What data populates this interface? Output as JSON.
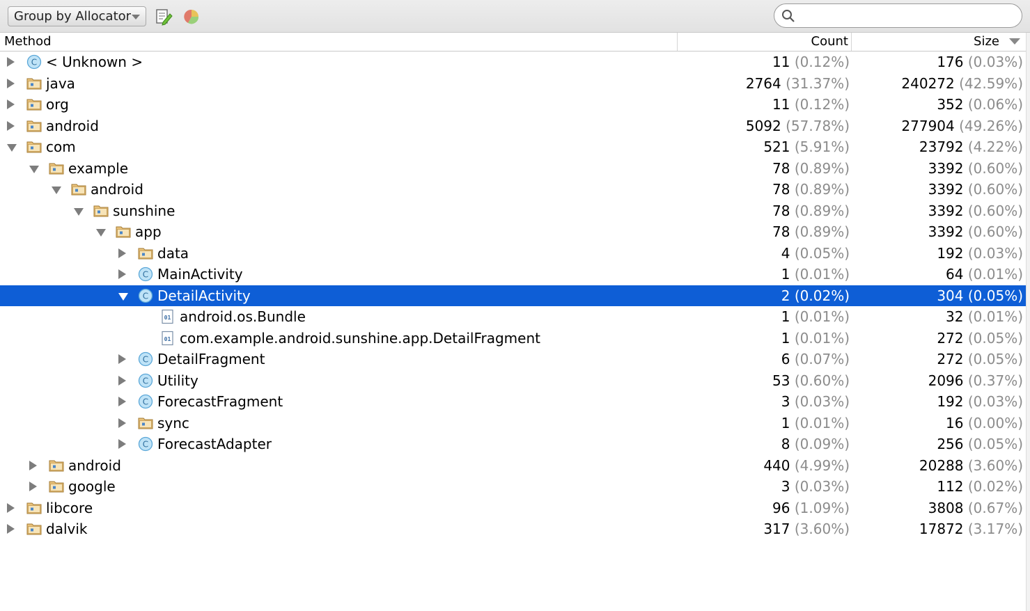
{
  "toolbar": {
    "group_by_label": "Group by Allocator",
    "icons": [
      "edit-export-icon",
      "pie-chart-icon",
      "search-icon"
    ],
    "search": {
      "value": "",
      "placeholder": ""
    }
  },
  "columns": {
    "method": "Method",
    "count": "Count",
    "size": "Size"
  },
  "colors": {
    "selection": "#0e5ed6",
    "percent": "#8c8c8c",
    "folder": "#c9a25a",
    "class_icon": "#7ec2e8"
  },
  "rows": [
    {
      "depth": 0,
      "state": "collapsed",
      "icon": "class",
      "name": "< Unknown >",
      "count": "11",
      "count_pct": "(0.12%)",
      "size": "176",
      "size_pct": "(0.03%)"
    },
    {
      "depth": 0,
      "state": "collapsed",
      "icon": "package",
      "name": "java",
      "count": "2764",
      "count_pct": "(31.37%)",
      "size": "240272",
      "size_pct": "(42.59%)"
    },
    {
      "depth": 0,
      "state": "collapsed",
      "icon": "package",
      "name": "org",
      "count": "11",
      "count_pct": "(0.12%)",
      "size": "352",
      "size_pct": "(0.06%)"
    },
    {
      "depth": 0,
      "state": "collapsed",
      "icon": "package",
      "name": "android",
      "count": "5092",
      "count_pct": "(57.78%)",
      "size": "277904",
      "size_pct": "(49.26%)"
    },
    {
      "depth": 0,
      "state": "expanded",
      "icon": "package",
      "name": "com",
      "count": "521",
      "count_pct": "(5.91%)",
      "size": "23792",
      "size_pct": "(4.22%)"
    },
    {
      "depth": 1,
      "state": "expanded",
      "icon": "package",
      "name": "example",
      "count": "78",
      "count_pct": "(0.89%)",
      "size": "3392",
      "size_pct": "(0.60%)"
    },
    {
      "depth": 2,
      "state": "expanded",
      "icon": "package",
      "name": "android",
      "count": "78",
      "count_pct": "(0.89%)",
      "size": "3392",
      "size_pct": "(0.60%)"
    },
    {
      "depth": 3,
      "state": "expanded",
      "icon": "package",
      "name": "sunshine",
      "count": "78",
      "count_pct": "(0.89%)",
      "size": "3392",
      "size_pct": "(0.60%)"
    },
    {
      "depth": 4,
      "state": "expanded",
      "icon": "package",
      "name": "app",
      "count": "78",
      "count_pct": "(0.89%)",
      "size": "3392",
      "size_pct": "(0.60%)"
    },
    {
      "depth": 5,
      "state": "collapsed",
      "icon": "package",
      "name": "data",
      "count": "4",
      "count_pct": "(0.05%)",
      "size": "192",
      "size_pct": "(0.03%)"
    },
    {
      "depth": 5,
      "state": "collapsed",
      "icon": "class",
      "name": "MainActivity",
      "count": "1",
      "count_pct": "(0.01%)",
      "size": "64",
      "size_pct": "(0.01%)"
    },
    {
      "depth": 5,
      "state": "expanded",
      "icon": "class",
      "name": "DetailActivity",
      "count": "2",
      "count_pct": "(0.02%)",
      "size": "304",
      "size_pct": "(0.05%)",
      "selected": true
    },
    {
      "depth": 6,
      "state": "leaf",
      "icon": "binary",
      "name": "android.os.Bundle",
      "count": "1",
      "count_pct": "(0.01%)",
      "size": "32",
      "size_pct": "(0.01%)"
    },
    {
      "depth": 6,
      "state": "leaf",
      "icon": "binary",
      "name": "com.example.android.sunshine.app.DetailFragment",
      "count": "1",
      "count_pct": "(0.01%)",
      "size": "272",
      "size_pct": "(0.05%)"
    },
    {
      "depth": 5,
      "state": "collapsed",
      "icon": "class",
      "name": "DetailFragment",
      "count": "6",
      "count_pct": "(0.07%)",
      "size": "272",
      "size_pct": "(0.05%)"
    },
    {
      "depth": 5,
      "state": "collapsed",
      "icon": "class",
      "name": "Utility",
      "count": "53",
      "count_pct": "(0.60%)",
      "size": "2096",
      "size_pct": "(0.37%)"
    },
    {
      "depth": 5,
      "state": "collapsed",
      "icon": "class",
      "name": "ForecastFragment",
      "count": "3",
      "count_pct": "(0.03%)",
      "size": "192",
      "size_pct": "(0.03%)"
    },
    {
      "depth": 5,
      "state": "collapsed",
      "icon": "package",
      "name": "sync",
      "count": "1",
      "count_pct": "(0.01%)",
      "size": "16",
      "size_pct": "(0.00%)"
    },
    {
      "depth": 5,
      "state": "collapsed",
      "icon": "class",
      "name": "ForecastAdapter",
      "count": "8",
      "count_pct": "(0.09%)",
      "size": "256",
      "size_pct": "(0.05%)"
    },
    {
      "depth": 1,
      "state": "collapsed",
      "icon": "package",
      "name": "android",
      "count": "440",
      "count_pct": "(4.99%)",
      "size": "20288",
      "size_pct": "(3.60%)"
    },
    {
      "depth": 1,
      "state": "collapsed",
      "icon": "package",
      "name": "google",
      "count": "3",
      "count_pct": "(0.03%)",
      "size": "112",
      "size_pct": "(0.02%)"
    },
    {
      "depth": 0,
      "state": "collapsed",
      "icon": "package",
      "name": "libcore",
      "count": "96",
      "count_pct": "(1.09%)",
      "size": "3808",
      "size_pct": "(0.67%)"
    },
    {
      "depth": 0,
      "state": "collapsed",
      "icon": "package",
      "name": "dalvik",
      "count": "317",
      "count_pct": "(3.60%)",
      "size": "17872",
      "size_pct": "(3.17%)"
    }
  ]
}
